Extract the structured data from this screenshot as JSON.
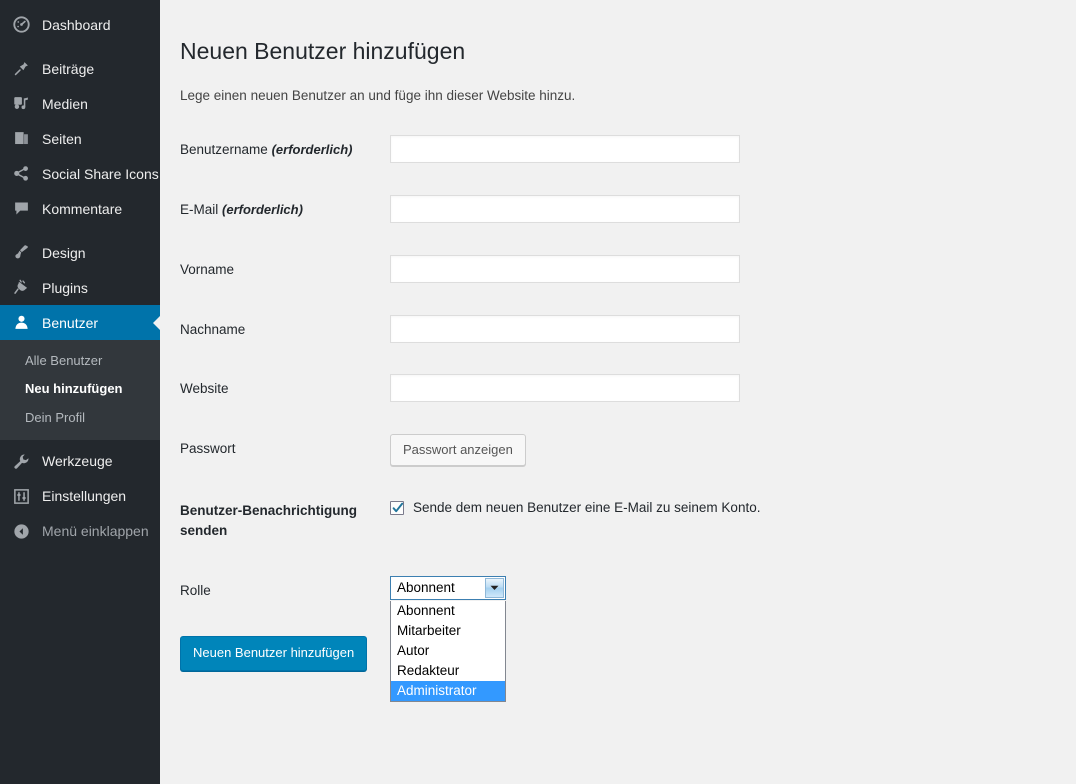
{
  "sidebar": {
    "items": [
      {
        "label": "Dashboard",
        "icon": "dashboard-icon",
        "name": "dashboard"
      },
      {
        "label": "Beiträge",
        "icon": "pin-icon",
        "name": "posts"
      },
      {
        "label": "Medien",
        "icon": "media-icon",
        "name": "media"
      },
      {
        "label": "Seiten",
        "icon": "pages-icon",
        "name": "pages"
      },
      {
        "label": "Social Share Icons",
        "icon": "share-icon",
        "name": "social-share-icons"
      },
      {
        "label": "Kommentare",
        "icon": "comment-icon",
        "name": "comments"
      },
      {
        "label": "Design",
        "icon": "brush-icon",
        "name": "appearance"
      },
      {
        "label": "Plugins",
        "icon": "plug-icon",
        "name": "plugins"
      },
      {
        "label": "Benutzer",
        "icon": "user-icon",
        "name": "users"
      },
      {
        "label": "Werkzeuge",
        "icon": "wrench-icon",
        "name": "tools"
      },
      {
        "label": "Einstellungen",
        "icon": "settings-icon",
        "name": "settings"
      },
      {
        "label": "Menü einklappen",
        "icon": "collapse-icon",
        "name": "collapse-menu"
      }
    ],
    "submenu": [
      {
        "label": "Alle Benutzer",
        "current": false
      },
      {
        "label": "Neu hinzufügen",
        "current": true
      },
      {
        "label": "Dein Profil",
        "current": false
      }
    ]
  },
  "main": {
    "title": "Neuen Benutzer hinzufügen",
    "description": "Lege einen neuen Benutzer an und füge ihn dieser Website hinzu.",
    "fields": {
      "username": {
        "label": "Benutzername",
        "hint": "(erforderlich)",
        "value": ""
      },
      "email": {
        "label": "E-Mail",
        "hint": "(erforderlich)",
        "value": ""
      },
      "firstname": {
        "label": "Vorname",
        "value": ""
      },
      "lastname": {
        "label": "Nachname",
        "value": ""
      },
      "website": {
        "label": "Website",
        "value": ""
      },
      "password": {
        "label": "Passwort",
        "button_label": "Passwort anzeigen"
      },
      "notification": {
        "label": "Benutzer-Benachrichtigung senden",
        "checkbox_label": "Sende dem neuen Benutzer eine E-Mail zu seinem Konto.",
        "checked": true
      },
      "role": {
        "label": "Rolle",
        "value": "Abonnent",
        "expanded": true,
        "options": [
          "Abonnent",
          "Mitarbeiter",
          "Autor",
          "Redakteur",
          "Administrator"
        ],
        "highlighted": "Administrator"
      }
    },
    "submit_label": "Neuen Benutzer hinzufügen"
  },
  "colors": {
    "sidebar_bg": "#23282d",
    "submenu_bg": "#32373c",
    "accent": "#0073aa",
    "primary_button": "#0085ba",
    "content_bg": "#f1f1f1",
    "option_highlight": "#3399ff"
  }
}
